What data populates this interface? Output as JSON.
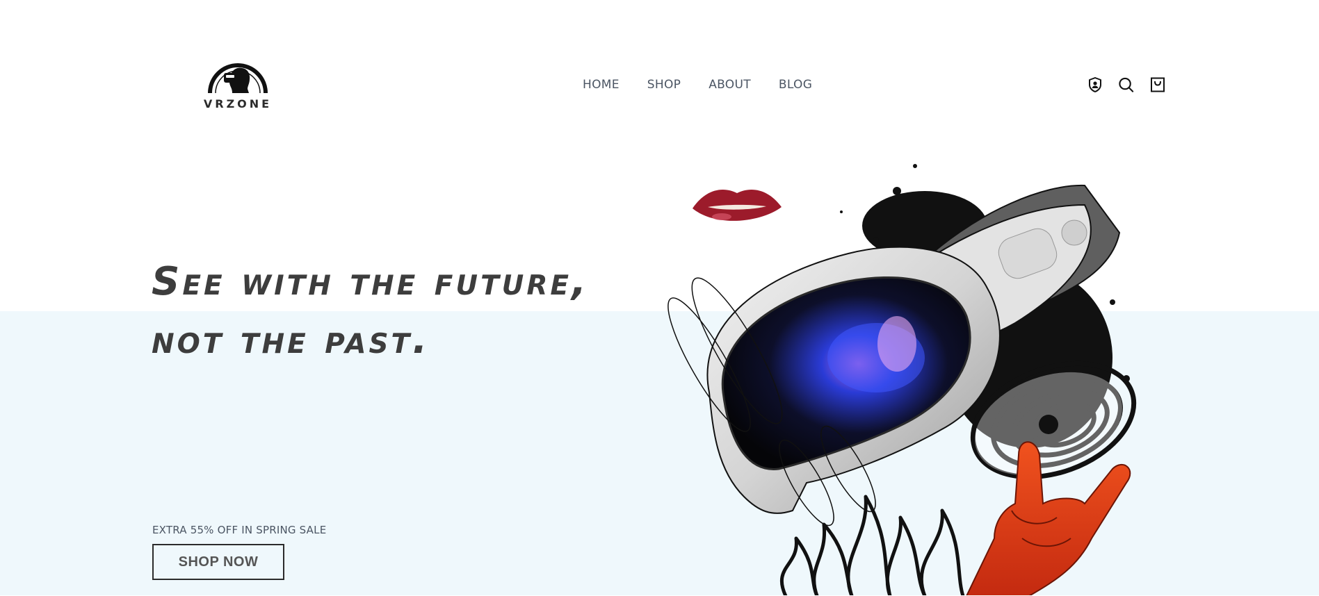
{
  "brand": {
    "name": "VRZONE"
  },
  "nav": {
    "items": [
      {
        "label": "HOME"
      },
      {
        "label": "SHOP"
      },
      {
        "label": "ABOUT"
      },
      {
        "label": "BLOG"
      }
    ]
  },
  "header_icons": {
    "account": "account-shield-icon",
    "search": "search-icon",
    "cart": "shopping-bag-icon"
  },
  "hero": {
    "headline_line1": "See with the future,",
    "headline_line2": "not the past.",
    "promo_text": "EXTRA 55% OFF IN SPRING SALE",
    "cta_label": "SHOP NOW",
    "art_alt": "VR headset collage illustration"
  },
  "colors": {
    "hero_background": "#eff8fc",
    "text_dark": "#3d3d3d",
    "nav_text": "#4b5563",
    "accent_red": "#e0371b"
  }
}
